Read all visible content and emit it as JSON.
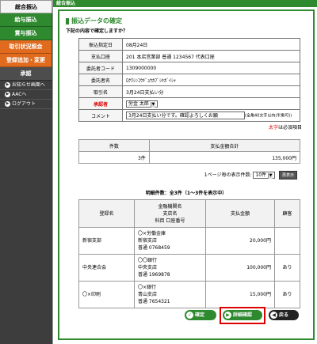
{
  "sidebar": {
    "items": [
      {
        "label": "総合振込",
        "style": "active"
      },
      {
        "label": "給与振込",
        "style": "green"
      },
      {
        "label": "賞与振込",
        "style": "green"
      },
      {
        "label": "取引状況照会",
        "style": "alt"
      },
      {
        "label": "登録追加・変更",
        "style": "alt"
      },
      {
        "label": "承認",
        "style": "dark"
      }
    ],
    "subnav": [
      {
        "label": "お知らせ画面へ"
      },
      {
        "label": "AACへ"
      },
      {
        "label": "ログアウト"
      }
    ]
  },
  "topbar": {
    "title": "総合振込"
  },
  "page": {
    "title": "振込データの確定",
    "subtitle": "下記の内容で確定しますか？"
  },
  "form": {
    "rows": [
      {
        "label": "振込指定日",
        "value": "08月24日"
      },
      {
        "label": "支払口座",
        "value": "201 本店営業部 普通 1234567 代表口座"
      },
      {
        "label": "委託者コード",
        "value": "1309000000"
      },
      {
        "label": "委託者名",
        "value": "ﾛｸﾜｼﾝｺｳｷﾞｮｳｶﾌﾞｼｷｶﾞｲｼｬ"
      },
      {
        "label": "取引名",
        "value": "3月24日支払い分"
      }
    ],
    "approver": {
      "label": "承認者",
      "value": "労金 太郎"
    },
    "comment": {
      "label": "コメント",
      "value": "3月24日支払い分です。確認よろしくお願",
      "hint": "(全角40文字以内(半角可))"
    }
  },
  "required_note": {
    "bold": "太字",
    "rest": "は必須項目"
  },
  "summary": {
    "headers": [
      "件数",
      "支払金額合計"
    ],
    "count": "3件",
    "total": "135,000円"
  },
  "perpage": {
    "label": "1ページ毎の表示件数:",
    "value": "10件",
    "button": "再表示"
  },
  "detail": {
    "title": "明細件数：全3件（1～3件を表示中）",
    "headers": {
      "name": "登録名",
      "bank1": "金融機関名",
      "bank2": "支店名",
      "bank3": "科目 口座番号",
      "amount": "支払金額",
      "fee": "顧客"
    },
    "rows": [
      {
        "name": "新宿支部",
        "bank": "〇×労働金庫",
        "branch": "新宿支店",
        "account": "普通 0768459",
        "amount": "20,000円",
        "fee": ""
      },
      {
        "name": "中央連合会",
        "bank": "〇〇銀行",
        "branch": "中央支店",
        "account": "普通 1969878",
        "amount": "100,000円",
        "fee": "あり"
      },
      {
        "name": "〇×印刷",
        "bank": "〇×銀行",
        "branch": "青山支店",
        "account": "普通 7654321",
        "amount": "15,000円",
        "fee": "あり"
      }
    ]
  },
  "actions": {
    "confirm": "確定",
    "detail": "詳細確認",
    "back": "戻る"
  },
  "colors": {
    "primary": "#2f8a2f",
    "accent": "#e06a1e",
    "dark": "#3d3d3d",
    "highlight": "#dd0000"
  }
}
